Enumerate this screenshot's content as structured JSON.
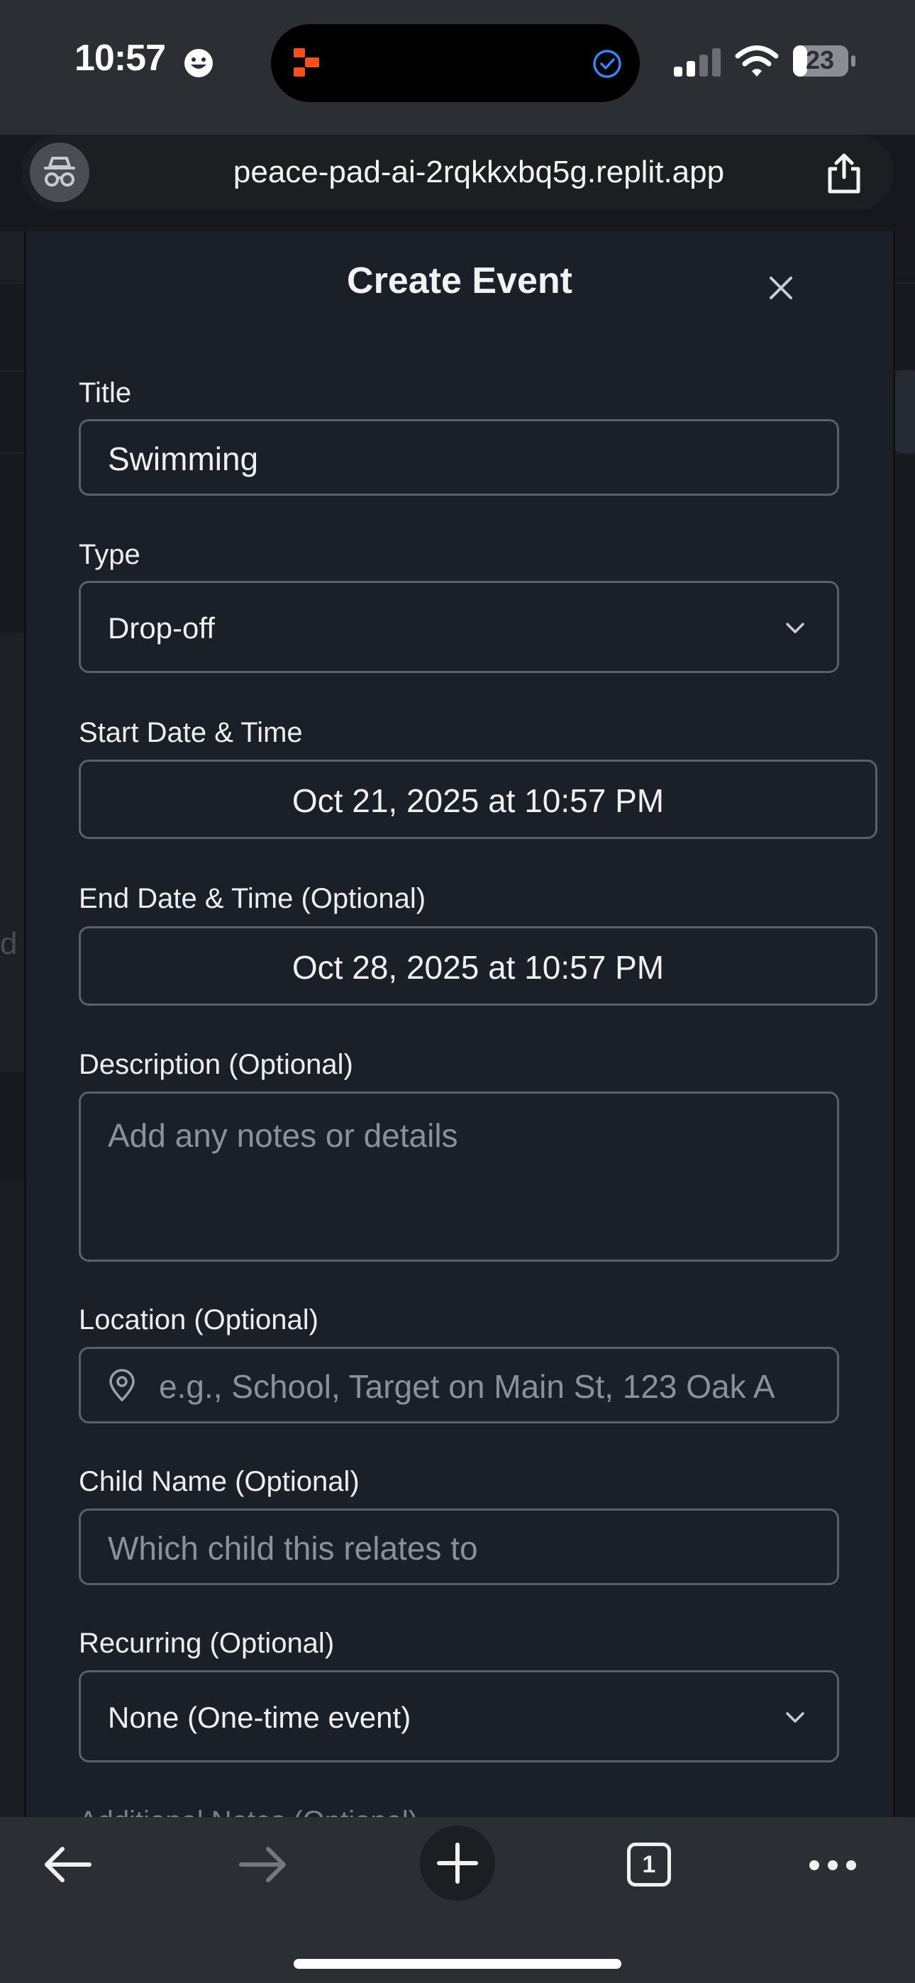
{
  "status_bar": {
    "time": "10:57",
    "battery": "23"
  },
  "browser": {
    "url": "peace-pad-ai-2rqkkxbq5g.replit.app"
  },
  "background_page": {
    "partial_letter": "d"
  },
  "modal": {
    "title": "Create Event",
    "fields": {
      "title": {
        "label": "Title",
        "value": "Swimming"
      },
      "type": {
        "label": "Type",
        "value": "Drop-off"
      },
      "start": {
        "label": "Start Date & Time",
        "value": "Oct 21, 2025 at 10:57 PM"
      },
      "end": {
        "label": "End Date & Time (Optional)",
        "value": "Oct 28, 2025 at 10:57 PM"
      },
      "description": {
        "label": "Description (Optional)",
        "placeholder": "Add any notes or details"
      },
      "location": {
        "label": "Location (Optional)",
        "placeholder": "e.g., School, Target on Main St, 123 Oak A"
      },
      "child_name": {
        "label": "Child Name (Optional)",
        "placeholder": "Which child this relates to"
      },
      "recurring": {
        "label": "Recurring (Optional)",
        "value": "None (One-time event)"
      },
      "additional_notes": {
        "label": "Additional Notes (Optional)"
      }
    }
  },
  "toolbar": {
    "tabs_count": "1"
  },
  "colors": {
    "modal_bg": "#1b1f27",
    "chrome_bg": "#2b2e32",
    "field_border": "#5a5f69",
    "placeholder": "#8b9099",
    "brand_orange": "#f4511e",
    "check_blue": "#3b82f6"
  }
}
